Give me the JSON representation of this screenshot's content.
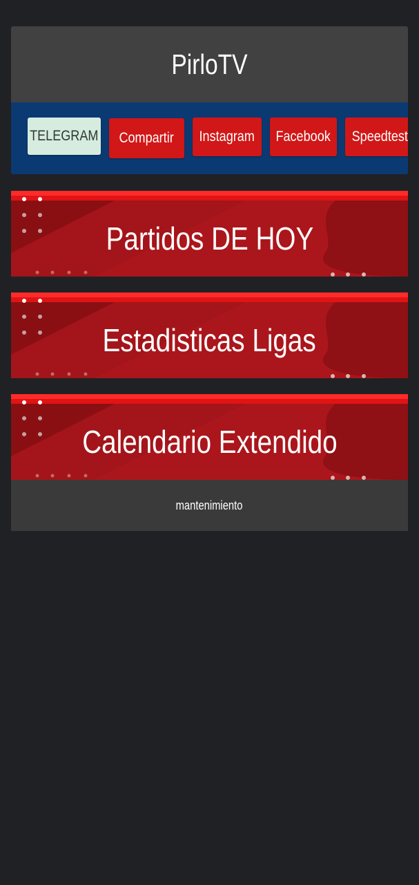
{
  "header": {
    "title": "PirloTV",
    "nav_buttons": [
      {
        "label": "TELEGRAM",
        "color": "#d5ecdf"
      },
      {
        "label": "Compartir",
        "color": "#d11717"
      },
      {
        "label": "Instagram",
        "color": "#d11717"
      },
      {
        "label": "Facebook",
        "color": "#d11717"
      },
      {
        "label": "Speedtest",
        "color": "#d11717"
      }
    ],
    "nav_bar_color": "#0b3a73"
  },
  "banners": [
    {
      "label": "Partidos DE HOY"
    },
    {
      "label": "Estadisticas Ligas"
    },
    {
      "label": "Calendario Extendido"
    }
  ],
  "footer": {
    "status_text": "mantenimiento"
  },
  "colors": {
    "background": "#202124",
    "banner_red": "#a3151a",
    "banner_accent": "#ff2b2b"
  }
}
